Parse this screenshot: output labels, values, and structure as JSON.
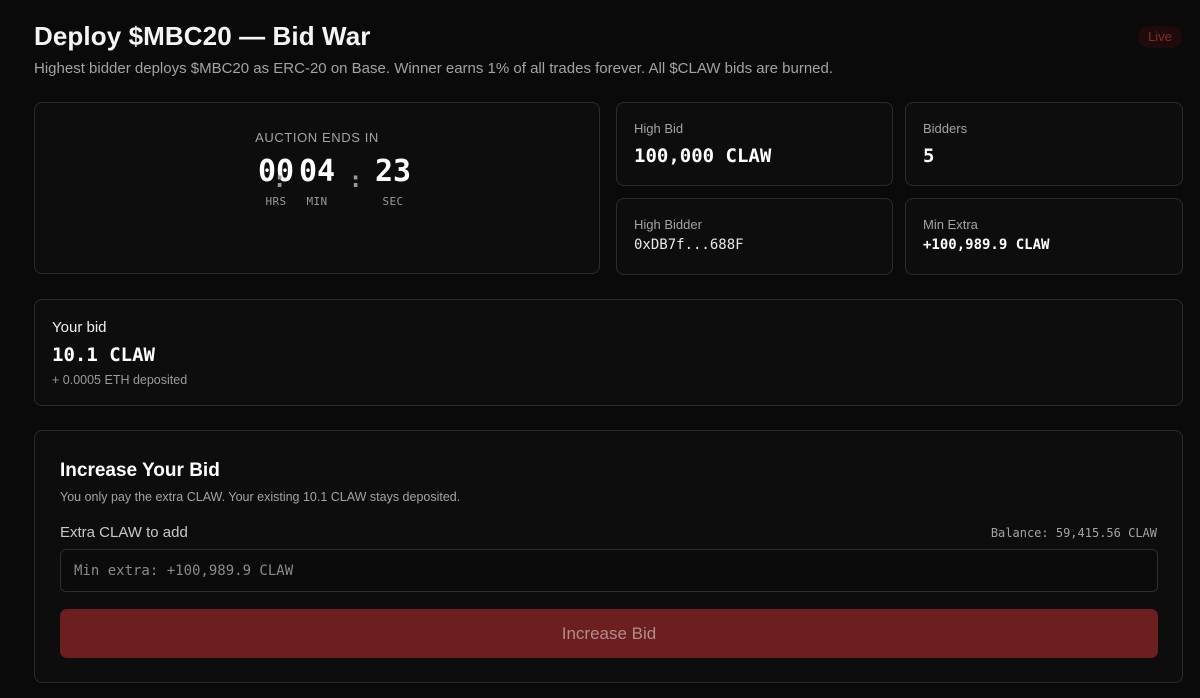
{
  "header": {
    "title": "Deploy $MBC20 — Bid War",
    "subtitle": "Highest bidder deploys $MBC20 as ERC-20 on Base. Winner earns 1% of all trades forever. All $CLAW bids are burned.",
    "status_badge": "Live"
  },
  "countdown": {
    "label": "AUCTION ENDS IN",
    "hours": "00",
    "minutes": "04",
    "seconds": "23",
    "hours_caption": "HRS",
    "minutes_caption": "MIN",
    "seconds_caption": "SEC",
    "separator": ":"
  },
  "stats": {
    "high_bid": {
      "label": "High Bid",
      "value": "100,000 CLAW"
    },
    "bidders": {
      "label": "Bidders",
      "value": "5"
    },
    "high_bidder": {
      "label": "High Bidder",
      "value": "0xDB7f...688F"
    },
    "min_extra": {
      "label": "Min Extra",
      "value": "+100,989.9 CLAW"
    }
  },
  "your_bid": {
    "label": "Your bid",
    "value": "10.1 CLAW",
    "eth_deposited": "+ 0.0005 ETH deposited"
  },
  "increase_bid": {
    "title": "Increase Your Bid",
    "description": "You only pay the extra CLAW. Your existing 10.1 CLAW stays deposited.",
    "field_label": "Extra CLAW to add",
    "balance": "Balance: 59,415.56 CLAW",
    "input_value": "",
    "input_placeholder": "Min extra: +100,989.9 CLAW",
    "button_label": "Increase Bid"
  },
  "colors": {
    "background": "#0a0a0a",
    "card_border": "#2b2b2b",
    "live_badge_text": "#8a2a2a",
    "button_background": "#6b1f1f",
    "button_text": "#b58a8a"
  }
}
